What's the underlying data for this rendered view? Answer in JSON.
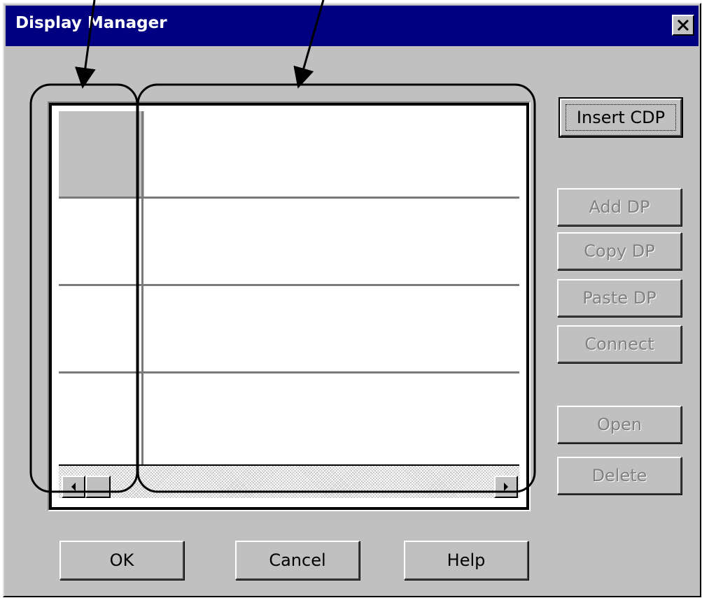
{
  "window": {
    "title": "Display Manager",
    "close_glyph": "✕"
  },
  "buttons": {
    "insert_cdp": "Insert CDP",
    "add_dp": "Add DP",
    "copy_dp": "Copy DP",
    "paste_dp": "Paste DP",
    "connect": "Connect",
    "open": "Open",
    "delete": "Delete",
    "ok": "OK",
    "cancel": "Cancel",
    "help": "Help"
  },
  "icons": {
    "close": "close-icon",
    "scroll_left": "scroll-left-arrow-icon",
    "scroll_right": "scroll-right-arrow-icon"
  },
  "grid": {
    "rows": 4,
    "columns": 2
  }
}
